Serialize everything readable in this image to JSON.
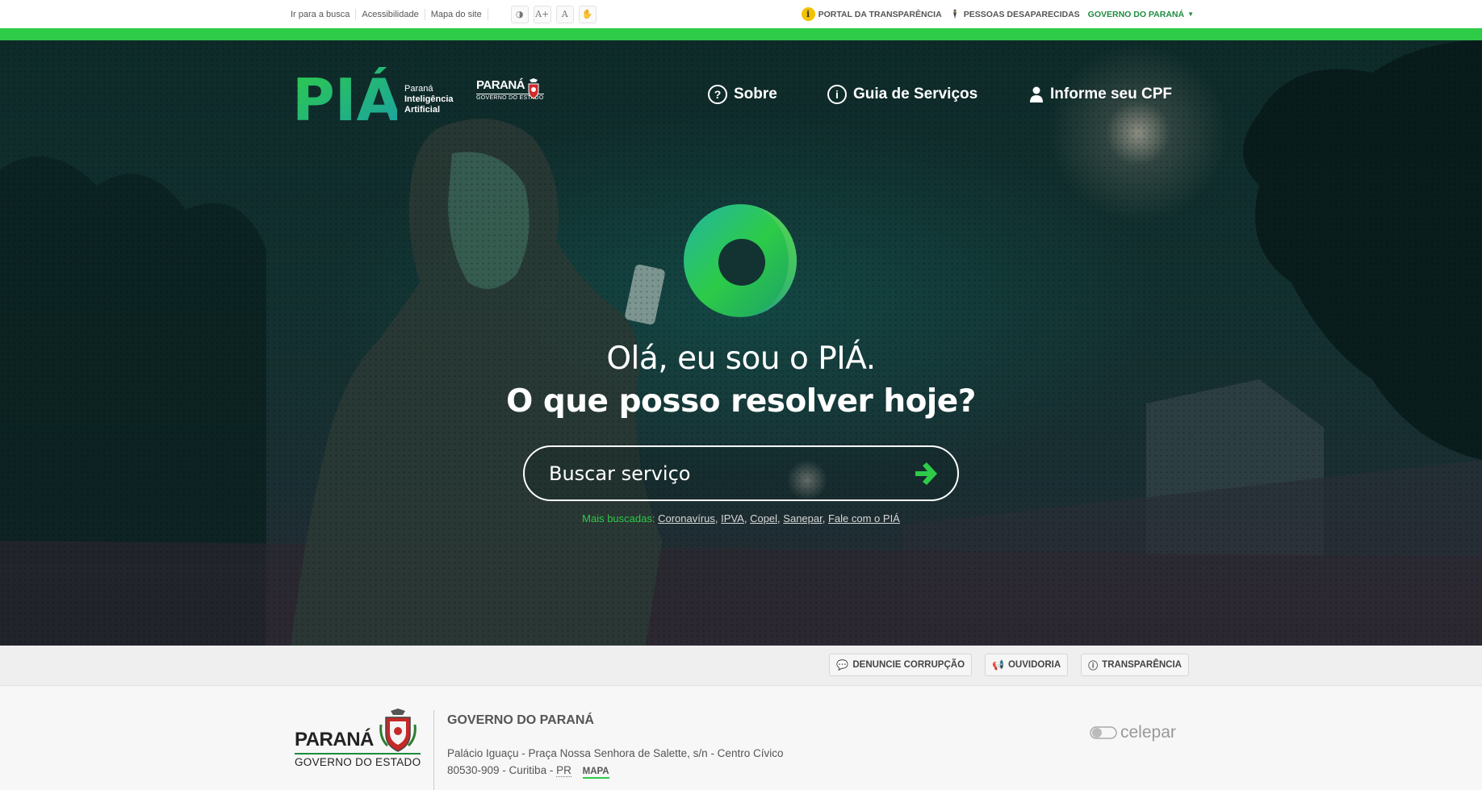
{
  "topbar": {
    "links": [
      "Ir para a busca",
      "Acessibilidade",
      "Mapa do site"
    ],
    "accessibility_buttons": [
      {
        "icon": "contrast-icon",
        "glyph": "◑"
      },
      {
        "icon": "font-increase-icon",
        "glyph": "A+"
      },
      {
        "icon": "font-reset-icon",
        "glyph": "A"
      },
      {
        "icon": "sign-language-icon",
        "glyph": "✋"
      }
    ],
    "transparency_label": "PORTAL DA TRANSPARÊNCIA",
    "missing_label": "PESSOAS DESAPARECIDAS",
    "gov_label": "GOVERNO DO PARANÁ"
  },
  "header": {
    "logo_text": "PIÁ",
    "logo_sub": [
      "Paraná",
      "Inteligência",
      "Artificial"
    ],
    "state_logo_name": "PARANÁ",
    "state_logo_sub": "GOVERNO DO ESTADO",
    "nav": [
      {
        "label": "Sobre",
        "icon": "question-icon"
      },
      {
        "label": "Guia de Serviços",
        "icon": "info-icon"
      },
      {
        "label": "Informe seu CPF",
        "icon": "user-icon"
      }
    ]
  },
  "hero": {
    "greeting": "Olá, eu sou o PIÁ.",
    "question": "O que posso resolver hoje?",
    "search_placeholder": "Buscar serviço",
    "popular_label": "Mais buscadas:",
    "popular_links": [
      "Coronavírus",
      "IPVA",
      "Copel",
      "Sanepar",
      "Fale com o PIÁ"
    ]
  },
  "quick_links": [
    {
      "label": "DENUNCIE CORRUPÇÃO",
      "icon": "chat-icon"
    },
    {
      "label": "OUVIDORIA",
      "icon": "megaphone-icon"
    },
    {
      "label": "TRANSPARÊNCIA",
      "icon": "info-icon"
    }
  ],
  "footer": {
    "logo_name": "PARANÁ",
    "logo_sub": "GOVERNO DO ESTADO",
    "title": "GOVERNO DO PARANÁ",
    "address_line1": "Palácio Iguaçu - Praça Nossa Senhora de Salette, s/n - Centro Cívico",
    "address_cep_city": "80530-909 - Curitiba - ",
    "address_state": "PR",
    "map_label": "MAPA",
    "partner": "celepar"
  },
  "colors": {
    "accent_green": "#2dcb48",
    "gov_green": "#1d8c3f",
    "hero_dark": "#12302f"
  }
}
